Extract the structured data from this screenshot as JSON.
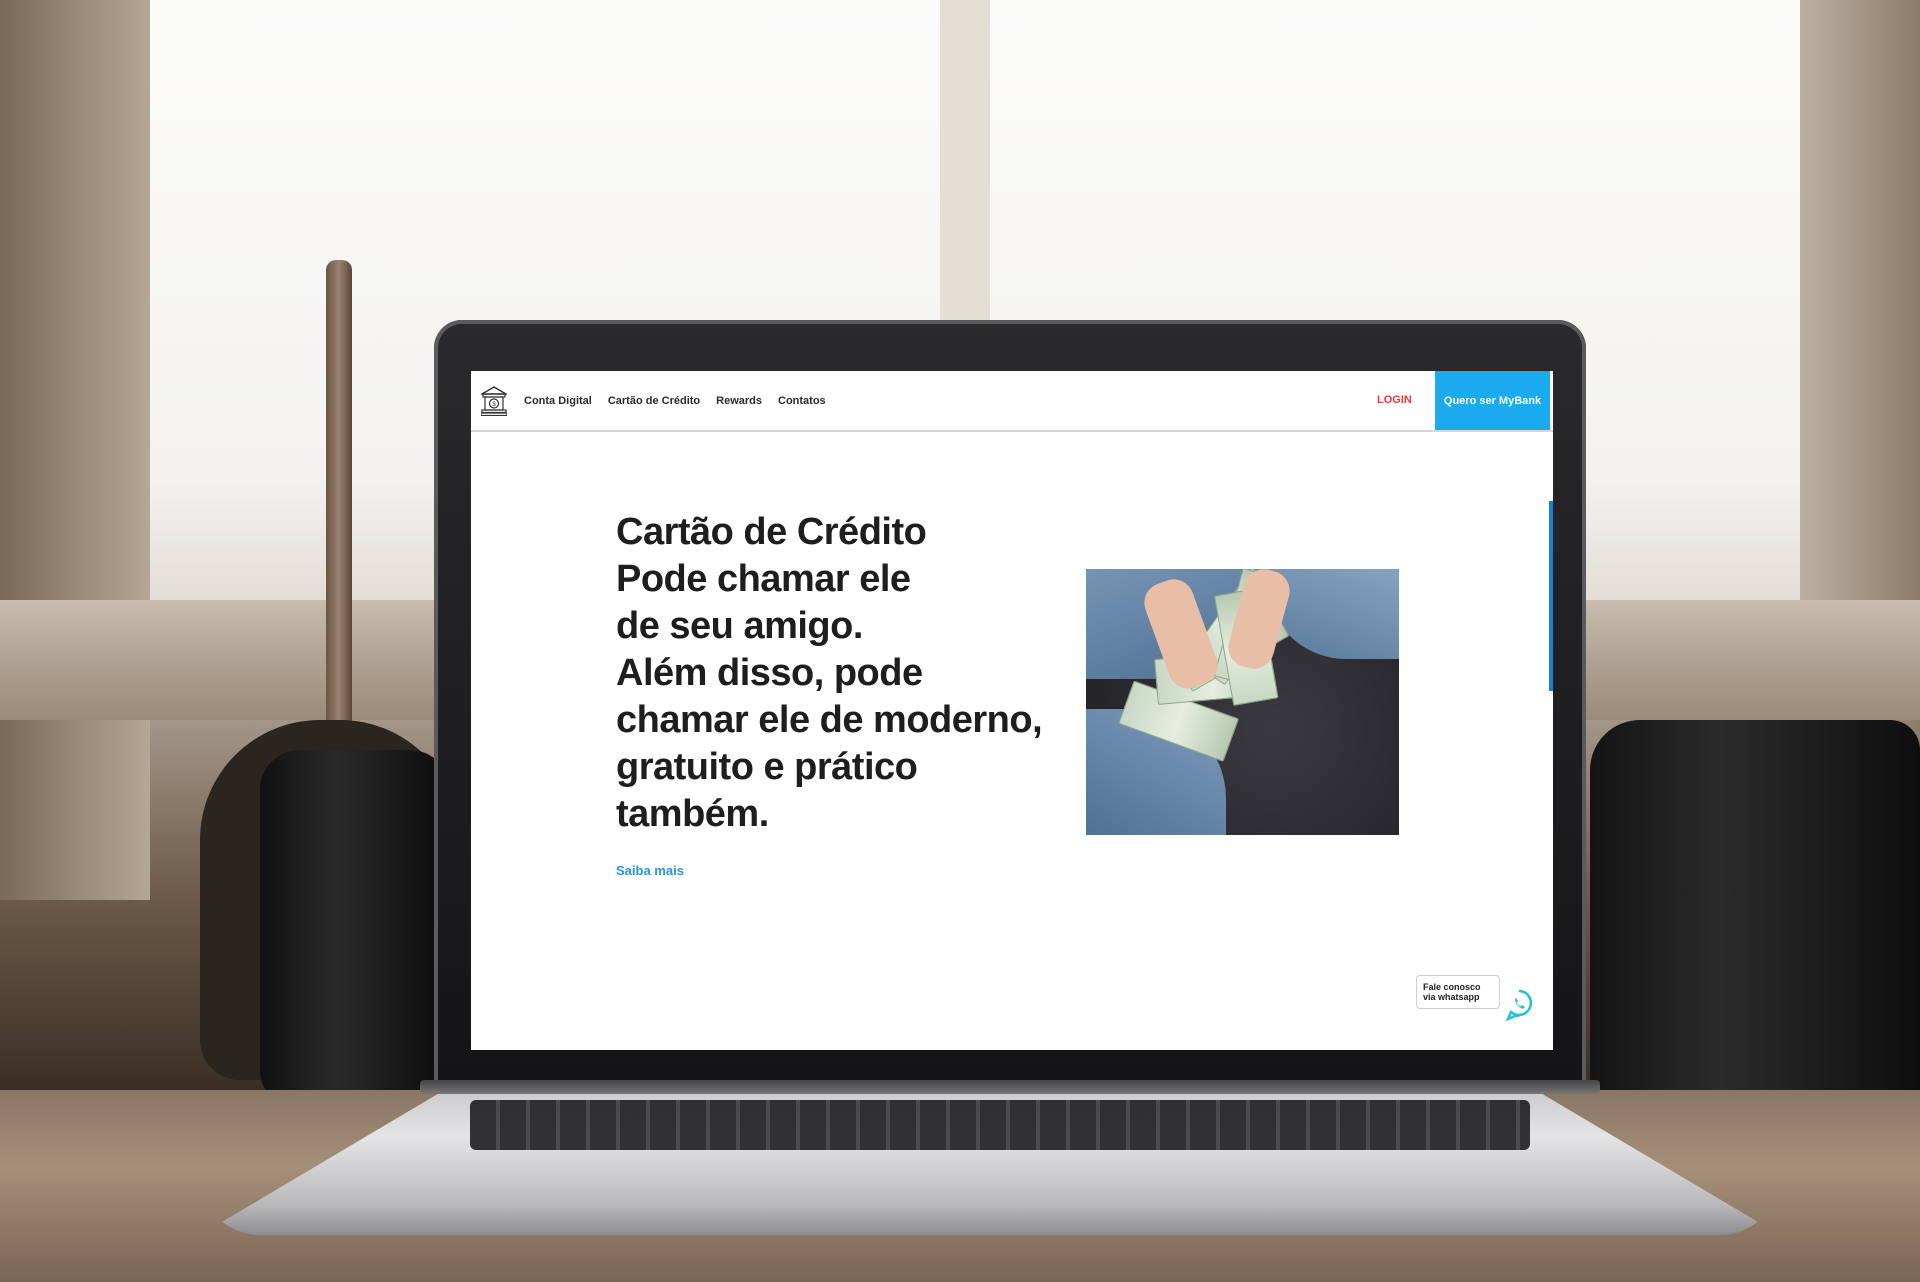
{
  "nav": {
    "items": [
      {
        "label": "Conta Digital"
      },
      {
        "label": "Cartão de Crédito"
      },
      {
        "label": "Rewards"
      },
      {
        "label": "Contatos"
      }
    ],
    "login_label": "LOGIN",
    "cta_label": "Quero ser MyBank",
    "logo_icon": "bank-icon"
  },
  "hero": {
    "title_lines": [
      "Cartão de Crédito",
      "Pode chamar ele",
      "de seu amigo.",
      "Além disso, pode",
      "chamar ele de moderno,",
      "gratuito e prático",
      "também."
    ],
    "link_label": "Saiba mais",
    "image_icon": "money-hands-photo"
  },
  "whatsapp": {
    "line1": "Fale conosco",
    "line2": "via whatsapp",
    "icon": "whatsapp-icon"
  },
  "colors": {
    "accent": "#1aaaf0",
    "login": "#e83a3a",
    "link": "#2196e6",
    "whatsapp": "#25c3d0"
  }
}
